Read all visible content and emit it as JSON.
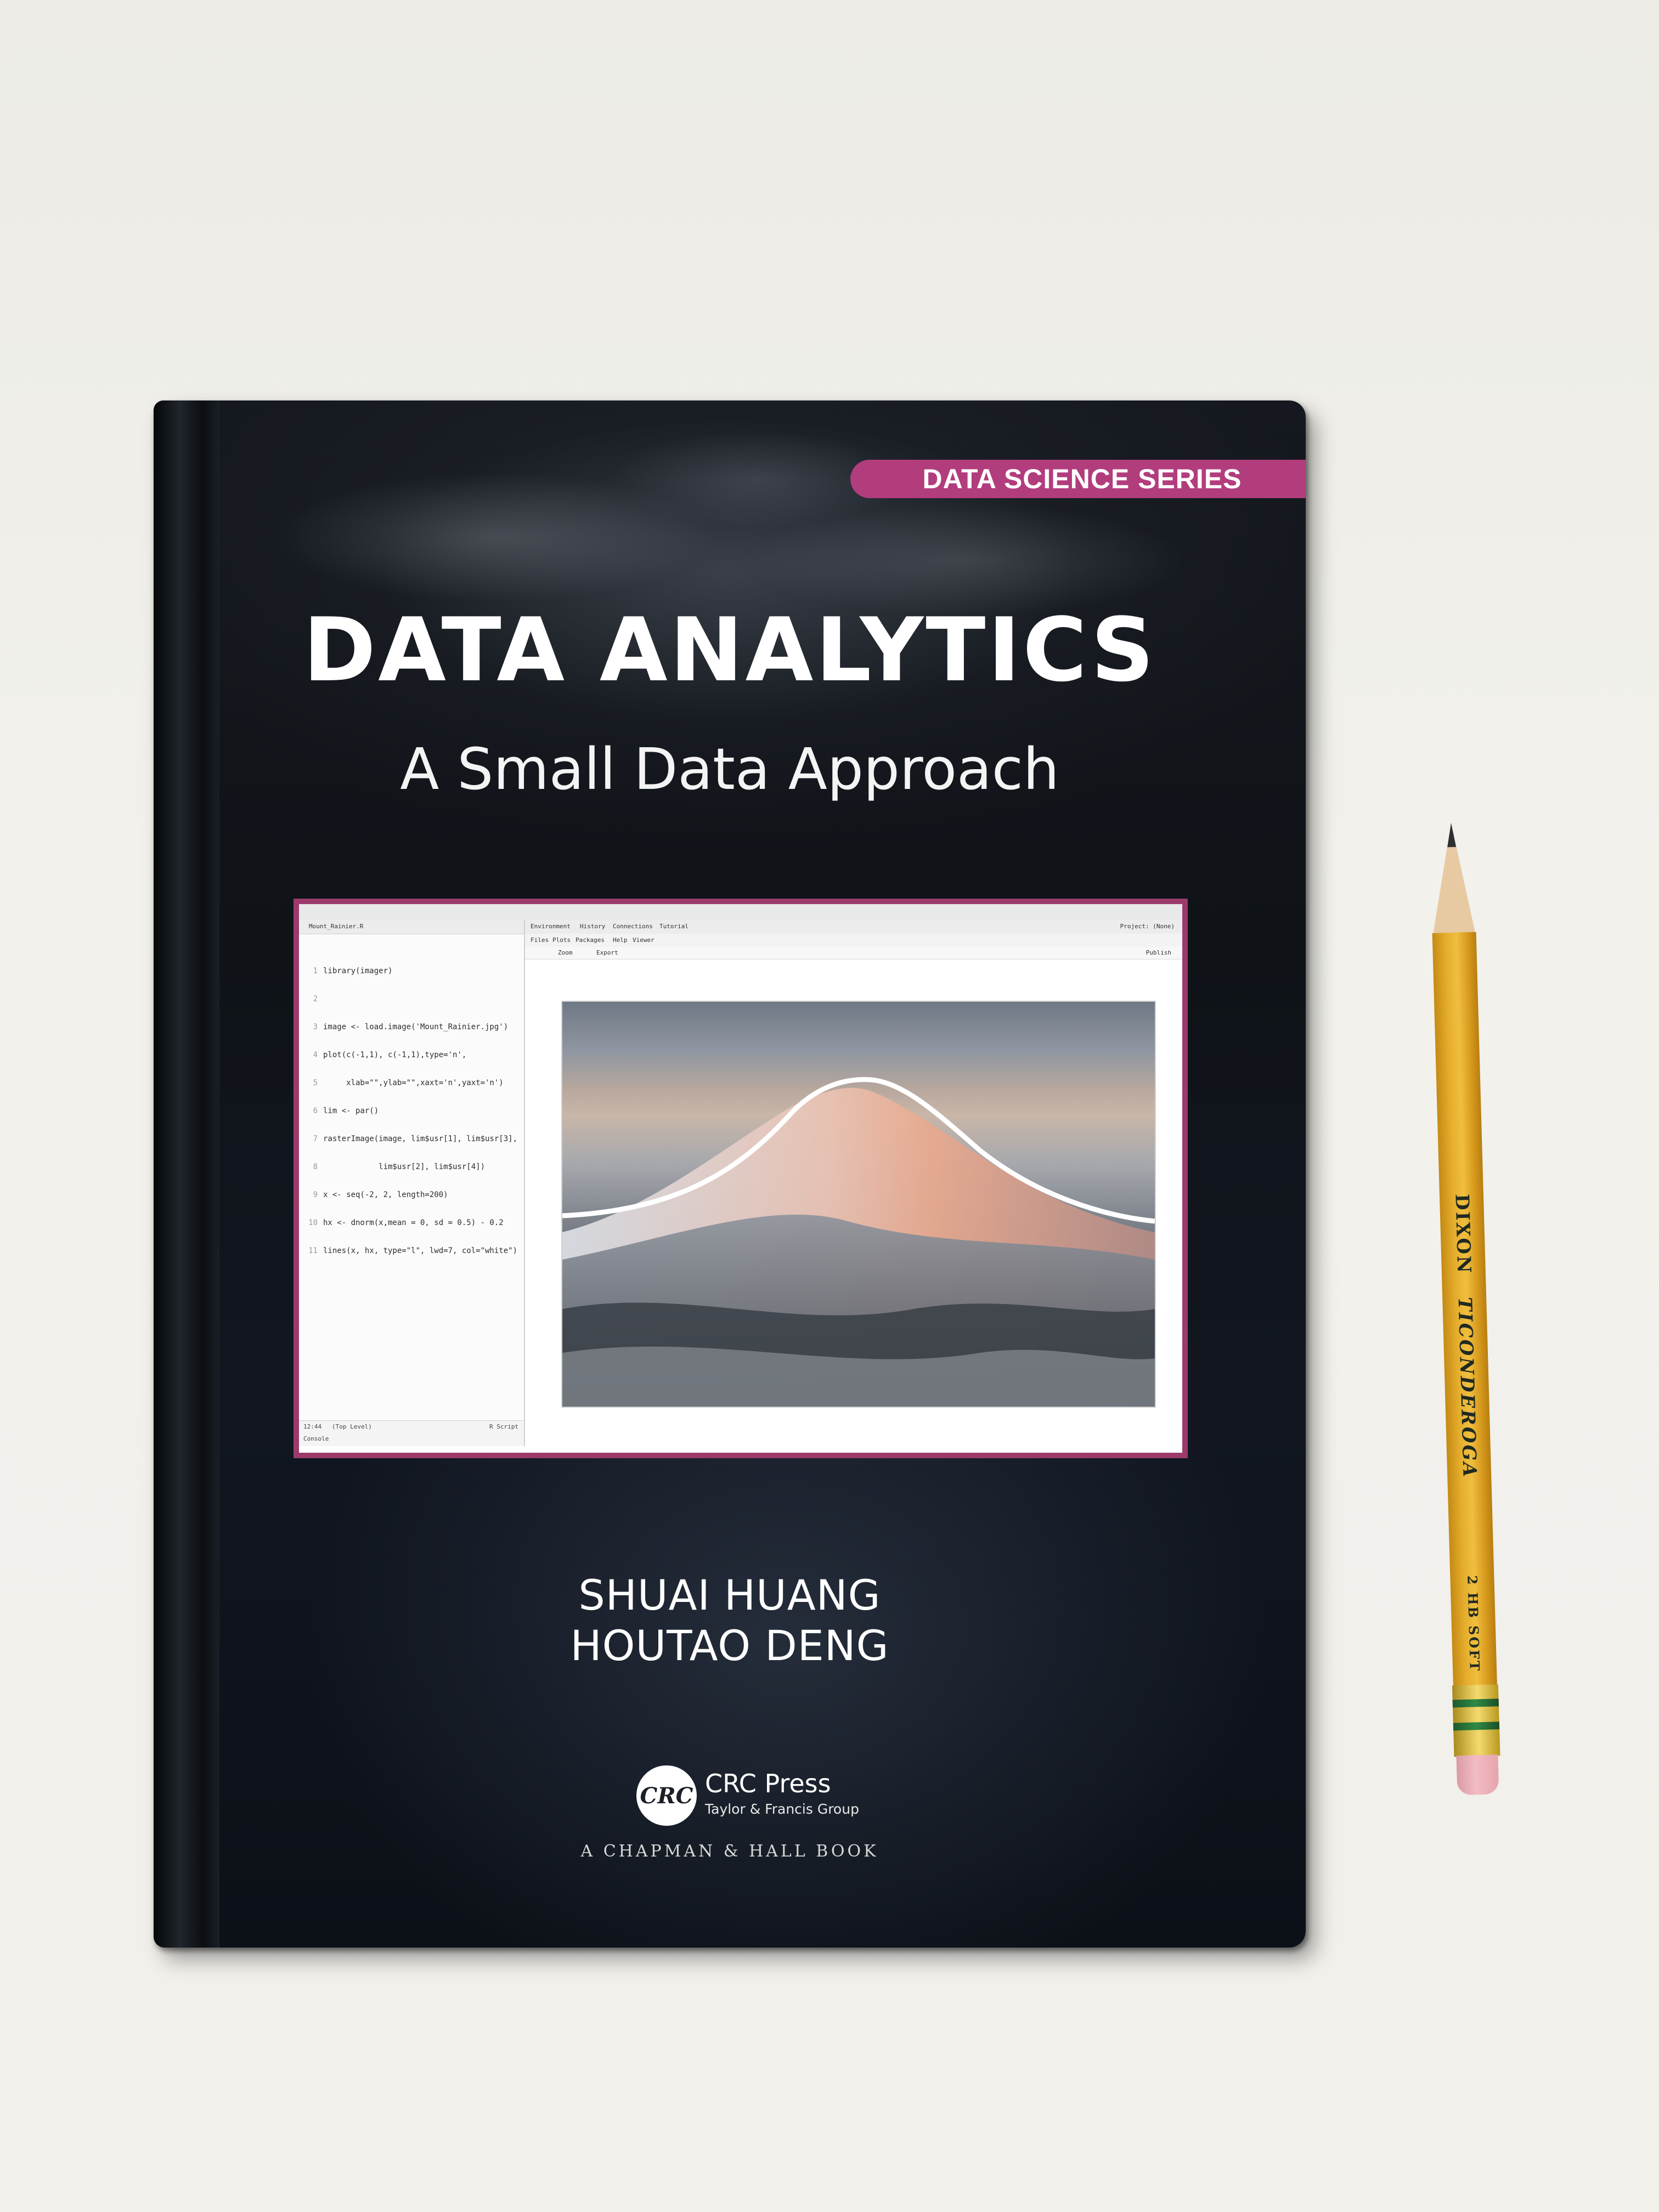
{
  "book": {
    "series": "DATA SCIENCE SERIES",
    "title": "DATA ANALYTICS",
    "subtitle": "A Small Data Approach",
    "authors": [
      "SHUAI HUANG",
      "HOUTAO DENG"
    ],
    "publisher": {
      "logo_text": "CRC",
      "name": "CRC Press",
      "group": "Taylor & Francis Group",
      "imprint": "A CHAPMAN & HALL BOOK"
    },
    "colors": {
      "accent": "#b23d7d",
      "cover": "#11161d"
    }
  },
  "screenshot": {
    "editor_tab": "Mount_Rainier.R",
    "code_lines": [
      "library(imager)",
      "",
      "image <- load.image('Mount_Rainier.jpg')",
      "plot(c(-1,1), c(-1,1),type='n',",
      "     xlab=\"\",ylab=\"\",xaxt='n',yaxt='n')",
      "lim <- par()",
      "rasterImage(image, lim$usr[1], lim$usr[3],",
      "            lim$usr[2], lim$usr[4])",
      "x <- seq(-2, 2, length=200)",
      "hx <- dnorm(x,mean = 0, sd = 0.5) - 0.2",
      "lines(x, hx, type=\"l\", lwd=7, col=\"white\")"
    ],
    "status_left": "12:44",
    "status_mid": "(Top Level)",
    "status_right": "R Script",
    "console_label": "Console",
    "env_tabs": [
      "Environment",
      "History",
      "Connections",
      "Tutorial"
    ],
    "viewer_tabs": [
      "Files",
      "Plots",
      "Packages",
      "Help",
      "Viewer"
    ],
    "plot_tools": [
      "Zoom",
      "Export"
    ],
    "project_label": "Project: (None)",
    "publish_label": "Publish"
  },
  "pencil": {
    "brand": "DIXON",
    "model": "TICONDEROGA",
    "grade": "2 HB SOFT"
  }
}
